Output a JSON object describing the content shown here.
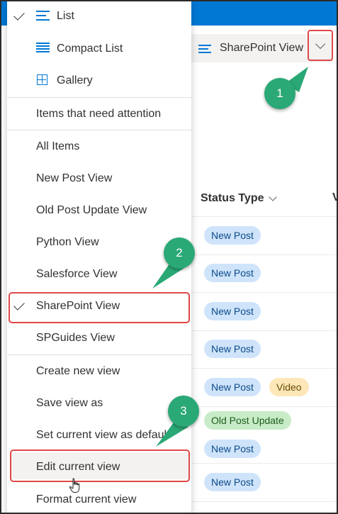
{
  "view_switcher": {
    "label": "SharePoint View"
  },
  "menu": {
    "layout_items": [
      {
        "label": "List",
        "checked": true,
        "icon": "list-icon"
      },
      {
        "label": "Compact List",
        "checked": false,
        "icon": "compact-list-icon"
      },
      {
        "label": "Gallery",
        "checked": false,
        "icon": "gallery-icon"
      }
    ],
    "attention_item": "Items that need attention",
    "views": [
      {
        "label": "All Items",
        "checked": false
      },
      {
        "label": "New Post View",
        "checked": false
      },
      {
        "label": "Old Post Update View",
        "checked": false
      },
      {
        "label": "Python View",
        "checked": false
      },
      {
        "label": "Salesforce View",
        "checked": false
      },
      {
        "label": "SharePoint View",
        "checked": true
      },
      {
        "label": "SPGuides View",
        "checked": false
      }
    ],
    "actions": [
      {
        "label": "Create new view"
      },
      {
        "label": "Save view as"
      },
      {
        "label": "Set current view as default"
      },
      {
        "label": "Edit current view"
      },
      {
        "label": "Format current view"
      }
    ]
  },
  "list": {
    "column_header": "Status Type",
    "next_column_initial": "V",
    "rows": [
      {
        "tags": [
          "New Post"
        ]
      },
      {
        "tags": [
          "New Post"
        ]
      },
      {
        "tags": [
          "New Post"
        ]
      },
      {
        "tags": [
          "New Post"
        ]
      },
      {
        "tags": [
          "New Post",
          "Video"
        ]
      },
      {
        "tags": [
          "Old Post Update",
          "New Post"
        ]
      },
      {
        "tags": [
          "New Post"
        ]
      }
    ]
  },
  "callouts": [
    "1",
    "2",
    "3"
  ],
  "colors": {
    "brand_blue": "#0078d4",
    "highlight_red": "#e04848",
    "callout_green": "#2aa876",
    "pill_blue": "#cfe4fa",
    "pill_gold": "#fde7b9",
    "pill_green": "#c8ecc7"
  }
}
